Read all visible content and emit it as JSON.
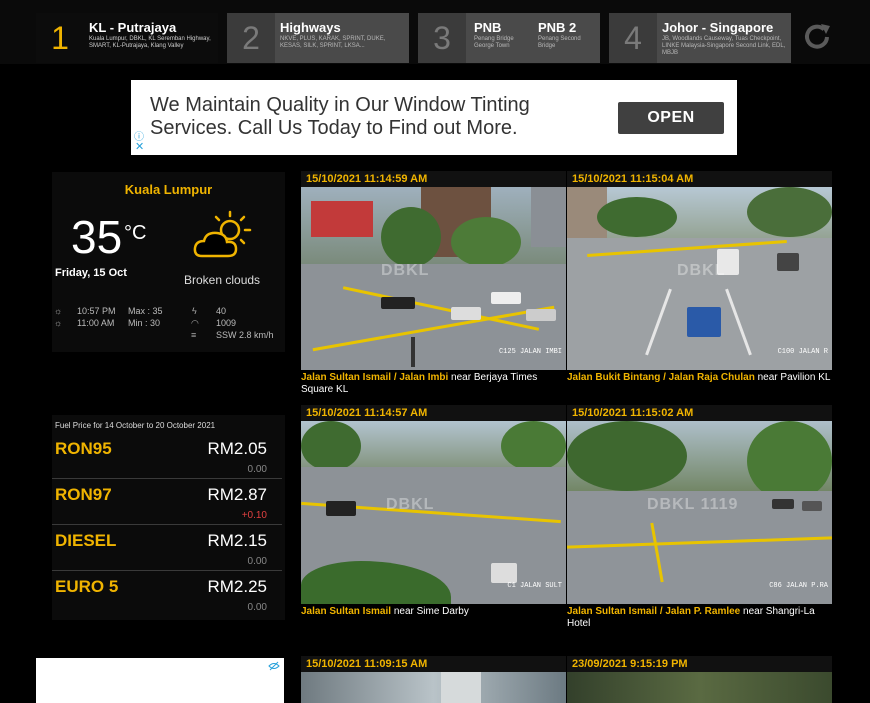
{
  "nav": {
    "tabs": [
      {
        "num": "1",
        "title": "KL - Putrajaya",
        "sub": "Kuala Lumpur, DBKL, KL Seremban Highway, SMART, KL-Putrajaya, Klang Valley"
      },
      {
        "num": "2",
        "title": "Highways",
        "sub": "NKVE, PLUS, KARAK, SPRINT, DUKE, KESAS, SILK, SPRINT, LKSA..."
      },
      {
        "num": "3",
        "title": "PNB",
        "sub": "Penang Bridge George Town",
        "title2": "PNB 2",
        "sub2": "Penang Second Bridge"
      },
      {
        "num": "4",
        "title": "Johor - Singapore",
        "sub": "JB, Woodlands Causeway, Tuas Checkpoint, LINKE Malaysia-Singapore Second Link, EDL, MBJB"
      }
    ],
    "refresh_icon": "refresh-icon"
  },
  "ad": {
    "text": "We Maintain Quality in Our Window Tinting Services. Call Us Today to Find out More.",
    "button": "OPEN",
    "info_icon": "ⓘ",
    "close_icon": "✕"
  },
  "weather": {
    "city": "Kuala Lumpur",
    "temp": "35",
    "unit": "°C",
    "date": "Friday, 15 Oct",
    "condition": "Broken clouds",
    "sunset": "10:57 PM",
    "sunrise": "11:00 AM",
    "max": "Max : 35",
    "min": "Min : 30",
    "humidity": "40",
    "pressure": "1009",
    "wind": "SSW 2.8 km/h"
  },
  "fuel": {
    "heading": "Fuel Price for 14 October to 20 October 2021",
    "rows": [
      {
        "name": "RON95",
        "price": "RM2.05",
        "change": "0.00",
        "up": false
      },
      {
        "name": "RON97",
        "price": "RM2.87",
        "change": "+0.10",
        "up": true
      },
      {
        "name": "DIESEL",
        "price": "RM2.15",
        "change": "0.00",
        "up": false
      },
      {
        "name": "EURO 5",
        "price": "RM2.25",
        "change": "0.00",
        "up": false
      }
    ]
  },
  "cameras": [
    {
      "ts": "15/10/2021 11:14:59 AM",
      "road": "Jalan Sultan Ismail / Jalan Imbi",
      "near": " near Berjaya Times Square KL",
      "stamp": "C125 JALAN IMBI"
    },
    {
      "ts": "15/10/2021 11:15:04 AM",
      "road": "Jalan Bukit Bintang / Jalan Raja Chulan",
      "near": " near Pavilion KL",
      "stamp": "C100 JALAN R"
    },
    {
      "ts": "15/10/2021 11:14:57 AM",
      "road": "Jalan Sultan Ismail",
      "near": " near Sime Darby",
      "stamp": "C1 JALAN SULT"
    },
    {
      "ts": "15/10/2021 11:15:02 AM",
      "road": "Jalan Sultan Ismail / Jalan P. Ramlee",
      "near": " near Shangri-La Hotel",
      "stamp": "C86 JALAN P.RA"
    },
    {
      "ts": "15/10/2021 11:09:15 AM",
      "road": "",
      "near": "",
      "stamp": ""
    },
    {
      "ts": "23/09/2021 9:15:19 PM",
      "road": "",
      "near": "",
      "stamp": ""
    }
  ],
  "watermark": "DBKL"
}
